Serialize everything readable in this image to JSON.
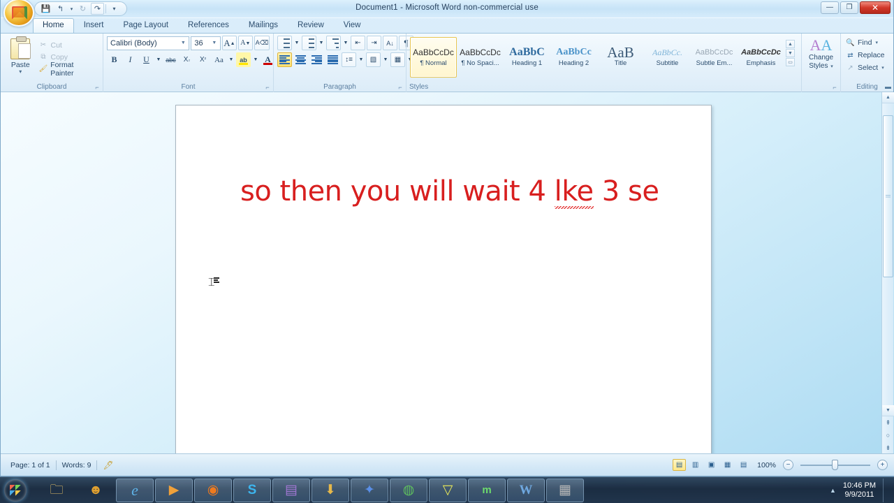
{
  "window": {
    "title": "Document1 - Microsoft Word non-commercial use",
    "minimize": "—",
    "restore": "❐",
    "close": "✕"
  },
  "quick_access": {
    "save": "save-icon",
    "undo": "↰",
    "undo_arrow": "▾",
    "redo": "↻",
    "repeat": "↷",
    "customize": "▾"
  },
  "office_button": {
    "label": "office-orb"
  },
  "tabs": [
    {
      "label": "Home",
      "active": true
    },
    {
      "label": "Insert",
      "active": false
    },
    {
      "label": "Page Layout",
      "active": false
    },
    {
      "label": "References",
      "active": false
    },
    {
      "label": "Mailings",
      "active": false
    },
    {
      "label": "Review",
      "active": false
    },
    {
      "label": "View",
      "active": false
    }
  ],
  "ribbon": {
    "clipboard": {
      "group_label": "Clipboard",
      "paste": "Paste",
      "paste_arrow": "▾",
      "cut": "Cut",
      "copy": "Copy",
      "format_painter": "Format Painter",
      "dialog_launcher": "⌐"
    },
    "font": {
      "group_label": "Font",
      "font_name": "Calibri (Body)",
      "font_size": "36",
      "grow_font": "A",
      "shrink_font": "A",
      "clear_formatting": "Aa",
      "bold": "B",
      "italic": "I",
      "underline": "U",
      "strikethrough": "abc",
      "subscript": "X",
      "superscript": "X",
      "change_case": "Aa",
      "highlight": "ab",
      "font_color": "A",
      "font_color_value": "#cc0000",
      "dialog_launcher": "⌐"
    },
    "paragraph": {
      "group_label": "Paragraph",
      "bullets": "bullets-icon",
      "numbering": "numbering-icon",
      "multilevel": "multilevel-list-icon",
      "decrease_indent": "decrease-indent-icon",
      "increase_indent": "increase-indent-icon",
      "sort": "A↓",
      "show_marks": "¶",
      "align_left": "align-left-icon",
      "align_center": "align-center-icon",
      "align_right": "align-right-icon",
      "justify": "justify-icon",
      "line_spacing": "line-spacing-icon",
      "shading": "shading-icon",
      "borders": "borders-icon",
      "dialog_launcher": "⌐"
    },
    "styles": {
      "group_label": "Styles",
      "items": [
        {
          "preview": "AaBbCcDc",
          "name": "¶ Normal",
          "selected": true
        },
        {
          "preview": "AaBbCcDc",
          "name": "¶ No Spaci...",
          "selected": false
        },
        {
          "preview": "AaBbC",
          "name": "Heading 1",
          "selected": false
        },
        {
          "preview": "AaBbCc",
          "name": "Heading 2",
          "selected": false
        },
        {
          "preview": "AaB",
          "name": "Title",
          "selected": false
        },
        {
          "preview": "AaBbCc.",
          "name": "Subtitle",
          "selected": false
        },
        {
          "preview": "AaBbCcDc",
          "name": "Subtle Em...",
          "selected": false
        },
        {
          "preview": "AaBbCcDc",
          "name": "Emphasis",
          "selected": false
        }
      ],
      "scroll_up": "▲",
      "scroll_down": "▼",
      "more": "▭",
      "dialog_launcher": "⌐"
    },
    "change_styles": {
      "label_line1": "Change",
      "label_line2": "Styles",
      "arrow": "▾"
    },
    "editing": {
      "group_label": "Editing",
      "find": "Find",
      "find_arrow": "▾",
      "replace": "Replace",
      "select": "Select",
      "select_arrow": "▾"
    }
  },
  "document": {
    "text_before": "so then you will wait 4 ",
    "misspelled_word": "lke",
    "text_after": " 3 se",
    "text_color": "#d81f1f",
    "cursor": "I-beam"
  },
  "status_bar": {
    "page": "Page: 1 of 1",
    "words": "Words: 9",
    "proofing": "proofing-errors-icon",
    "views": [
      {
        "name": "print-layout-view",
        "glyph": "▤",
        "active": true
      },
      {
        "name": "full-screen-reading-view",
        "glyph": "▥",
        "active": false
      },
      {
        "name": "web-layout-view",
        "glyph": "▣",
        "active": false
      },
      {
        "name": "outline-view",
        "glyph": "▦",
        "active": false
      },
      {
        "name": "draft-view",
        "glyph": "▤",
        "active": false
      }
    ],
    "zoom_level": "100%",
    "zoom_out": "−",
    "zoom_in": "+"
  },
  "scrollbar": {
    "up": "▲",
    "down": "▼",
    "split": "▬",
    "previous_page": "⇞",
    "select_browse_object": "○",
    "next_page": "⇟"
  },
  "taskbar": {
    "start": "start-orb",
    "items": [
      {
        "name": "windows-explorer",
        "glyph": "🗂",
        "color": "#e8c36a",
        "running": false
      },
      {
        "name": "media-character-app",
        "glyph": "●",
        "color": "#e0a030",
        "running": false
      },
      {
        "name": "internet-explorer",
        "glyph": "e",
        "color": "#1f7ec4",
        "running": true
      },
      {
        "name": "windows-media-player",
        "glyph": "▶",
        "color": "#e08a1e",
        "running": true
      },
      {
        "name": "mozilla-firefox",
        "glyph": "◉",
        "color": "#e06a1e",
        "running": true
      },
      {
        "name": "skype",
        "glyph": "S",
        "color": "#2aa8e0",
        "running": true
      },
      {
        "name": "purple-app",
        "glyph": "▤",
        "color": "#8b5fbf",
        "running": true
      },
      {
        "name": "download-manager",
        "glyph": "⬇",
        "color": "#d9a43a",
        "running": true
      },
      {
        "name": "rocket-app",
        "glyph": "✈",
        "color": "#3a6fd9",
        "running": true
      },
      {
        "name": "google-chrome",
        "glyph": "◍",
        "color": "#4a9d4a",
        "running": true
      },
      {
        "name": "funnel-app",
        "glyph": "▼",
        "color": "#d8d83a",
        "running": true
      },
      {
        "name": "m-app",
        "glyph": "m",
        "color": "#5ac85a",
        "running": true
      },
      {
        "name": "microsoft-word",
        "glyph": "W",
        "color": "#2a5fa8",
        "running": true
      },
      {
        "name": "video-editor",
        "glyph": "▦",
        "color": "#8a8a8a",
        "running": true
      }
    ],
    "tray_arrow": "▲",
    "time": "10:46 PM",
    "date": "9/9/2011"
  }
}
